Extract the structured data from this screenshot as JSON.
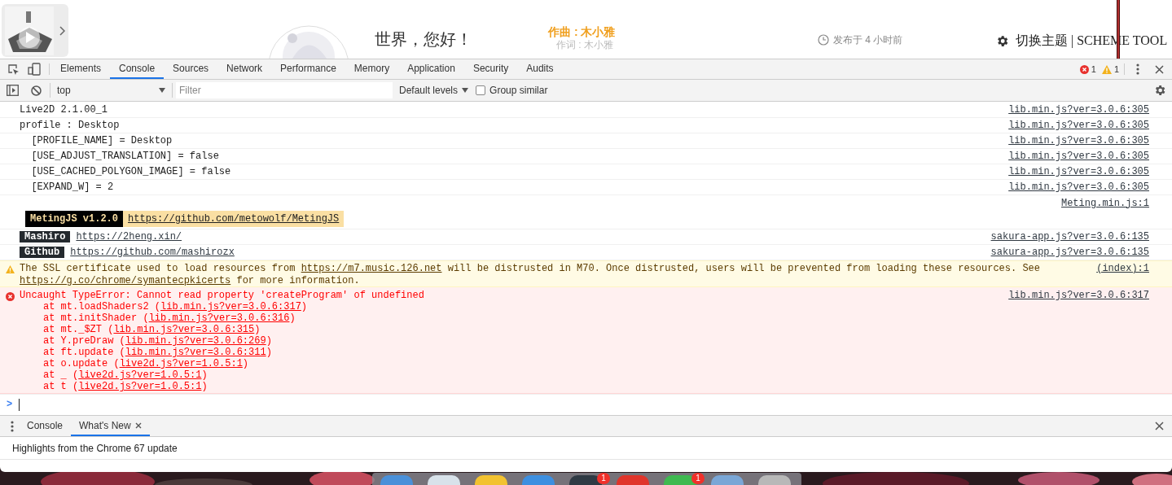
{
  "page": {
    "title": "世界，您好！",
    "composer": "作曲 : 木小雅",
    "lyricist": "作词 : 木小雅",
    "published": "发布于 4 小时前",
    "theme_switch": "切换主题 | SCHEME TOOL"
  },
  "devtools": {
    "tabs": [
      {
        "label": "Elements",
        "selected": false
      },
      {
        "label": "Console",
        "selected": true
      },
      {
        "label": "Sources",
        "selected": false
      },
      {
        "label": "Network",
        "selected": false
      },
      {
        "label": "Performance",
        "selected": false
      },
      {
        "label": "Memory",
        "selected": false
      },
      {
        "label": "Application",
        "selected": false
      },
      {
        "label": "Security",
        "selected": false
      },
      {
        "label": "Audits",
        "selected": false
      }
    ],
    "error_count": "1",
    "warning_count": "1"
  },
  "toolbar": {
    "context": "top",
    "filter_placeholder": "Filter",
    "levels": "Default levels",
    "group_similar": {
      "label": "Group similar",
      "checked": false
    }
  },
  "messages": [
    {
      "kind": "log",
      "text": "Live2D 2.1.00_1",
      "source": "lib.min.js?ver=3.0.6:305"
    },
    {
      "kind": "log",
      "text": "profile : Desktop",
      "source": "lib.min.js?ver=3.0.6:305"
    },
    {
      "kind": "log",
      "text": "  [PROFILE_NAME] = Desktop",
      "source": "lib.min.js?ver=3.0.6:305"
    },
    {
      "kind": "log",
      "text": "  [USE_ADJUST_TRANSLATION] = false",
      "source": "lib.min.js?ver=3.0.6:305"
    },
    {
      "kind": "log",
      "text": "  [USE_CACHED_POLYGON_IMAGE] = false",
      "source": "lib.min.js?ver=3.0.6:305"
    },
    {
      "kind": "log",
      "text": "  [EXPAND_W] = 2",
      "source": "lib.min.js?ver=3.0.6:305"
    },
    {
      "kind": "banner",
      "badge": "MetingJS v1.2.0",
      "link": "https://github.com/metowolf/MetingJS",
      "source": "Meting.min.js:1"
    },
    {
      "kind": "badge",
      "badge": "Mashiro",
      "link": "https://2heng.xin/",
      "source": "sakura-app.js?ver=3.0.6:135"
    },
    {
      "kind": "badge",
      "badge": "Github",
      "link": "https://github.com/mashirozx",
      "source": "sakura-app.js?ver=3.0.6:135"
    },
    {
      "kind": "warning",
      "parts": [
        {
          "text": "The SSL certificate used to load resources from "
        },
        {
          "link": "https://m7.music.126.net"
        },
        {
          "text": " will be distrusted in M70. Once distrusted, users will be prevented from loading these resources. See "
        },
        {
          "link": "https://g.co/chrome/symantecpkicerts"
        },
        {
          "text": " for more information."
        }
      ],
      "source": "(index):1"
    },
    {
      "kind": "error",
      "text": "Uncaught TypeError: Cannot read property 'createProgram' of undefined",
      "source": "lib.min.js?ver=3.0.6:317",
      "stack": [
        {
          "prefix": "at mt.loadShaders2 (",
          "link": "lib.min.js?ver=3.0.6:317",
          "suffix": ")"
        },
        {
          "prefix": "at mt.initShader (",
          "link": "lib.min.js?ver=3.0.6:316",
          "suffix": ")"
        },
        {
          "prefix": "at mt._$ZT (",
          "link": "lib.min.js?ver=3.0.6:315",
          "suffix": ")"
        },
        {
          "prefix": "at Y.preDraw (",
          "link": "lib.min.js?ver=3.0.6:269",
          "suffix": ")"
        },
        {
          "prefix": "at ft.update (",
          "link": "lib.min.js?ver=3.0.6:311",
          "suffix": ")"
        },
        {
          "prefix": "at o.update (",
          "link": "live2d.js?ver=1.0.5:1",
          "suffix": ")"
        },
        {
          "prefix": "at _ (",
          "link": "live2d.js?ver=1.0.5:1",
          "suffix": ")"
        },
        {
          "prefix": "at t (",
          "link": "live2d.js?ver=1.0.5:1",
          "suffix": ")"
        }
      ]
    }
  ],
  "prompt": {
    "symbol": ">"
  },
  "drawer": {
    "tabs": [
      {
        "label": "Console",
        "selected": false
      },
      {
        "label": "What's New",
        "selected": true
      }
    ],
    "content": "Highlights from the Chrome 67 update"
  },
  "dock": {
    "items": [
      {
        "color": "#4a90d9"
      },
      {
        "color": "#d8e2ea"
      },
      {
        "color": "#f2c230"
      },
      {
        "color": "#3d8fe0"
      },
      {
        "color": "#2f3a44",
        "badge": "1"
      },
      {
        "color": "#e0352b"
      },
      {
        "color": "#3fb950",
        "badge": "1"
      },
      {
        "color": "#7aa6d6"
      },
      {
        "color": "#b8b8b8"
      }
    ]
  }
}
